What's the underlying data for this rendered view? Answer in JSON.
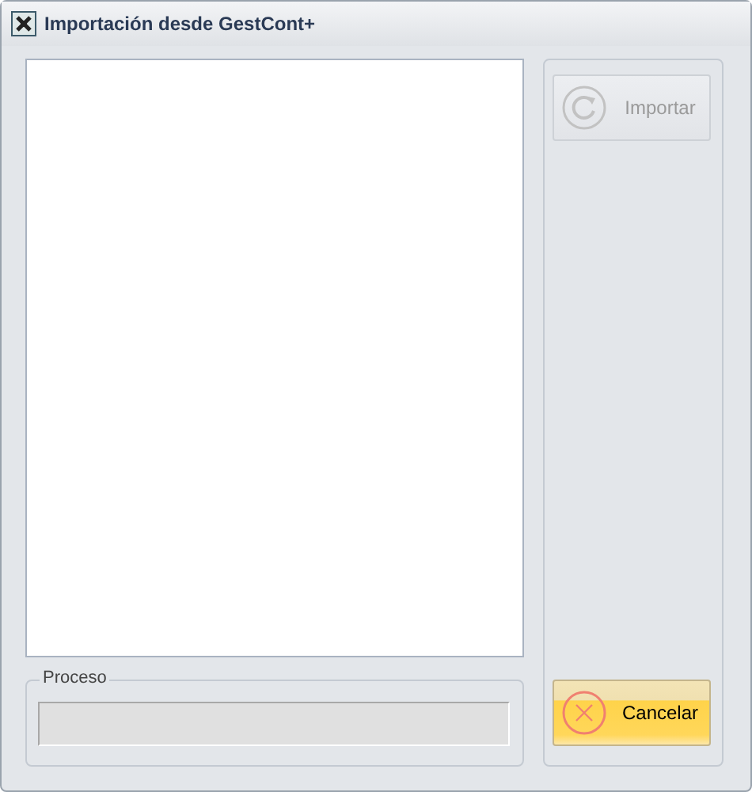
{
  "window": {
    "title": "Importación desde GestCont+"
  },
  "progress": {
    "label": "Proceso",
    "level": 0
  },
  "buttons": [
    {
      "kind": "import",
      "label": "Importar",
      "disabled": true
    },
    {
      "kind": "cancel",
      "label": "Cancelar",
      "disabled": false
    }
  ]
}
